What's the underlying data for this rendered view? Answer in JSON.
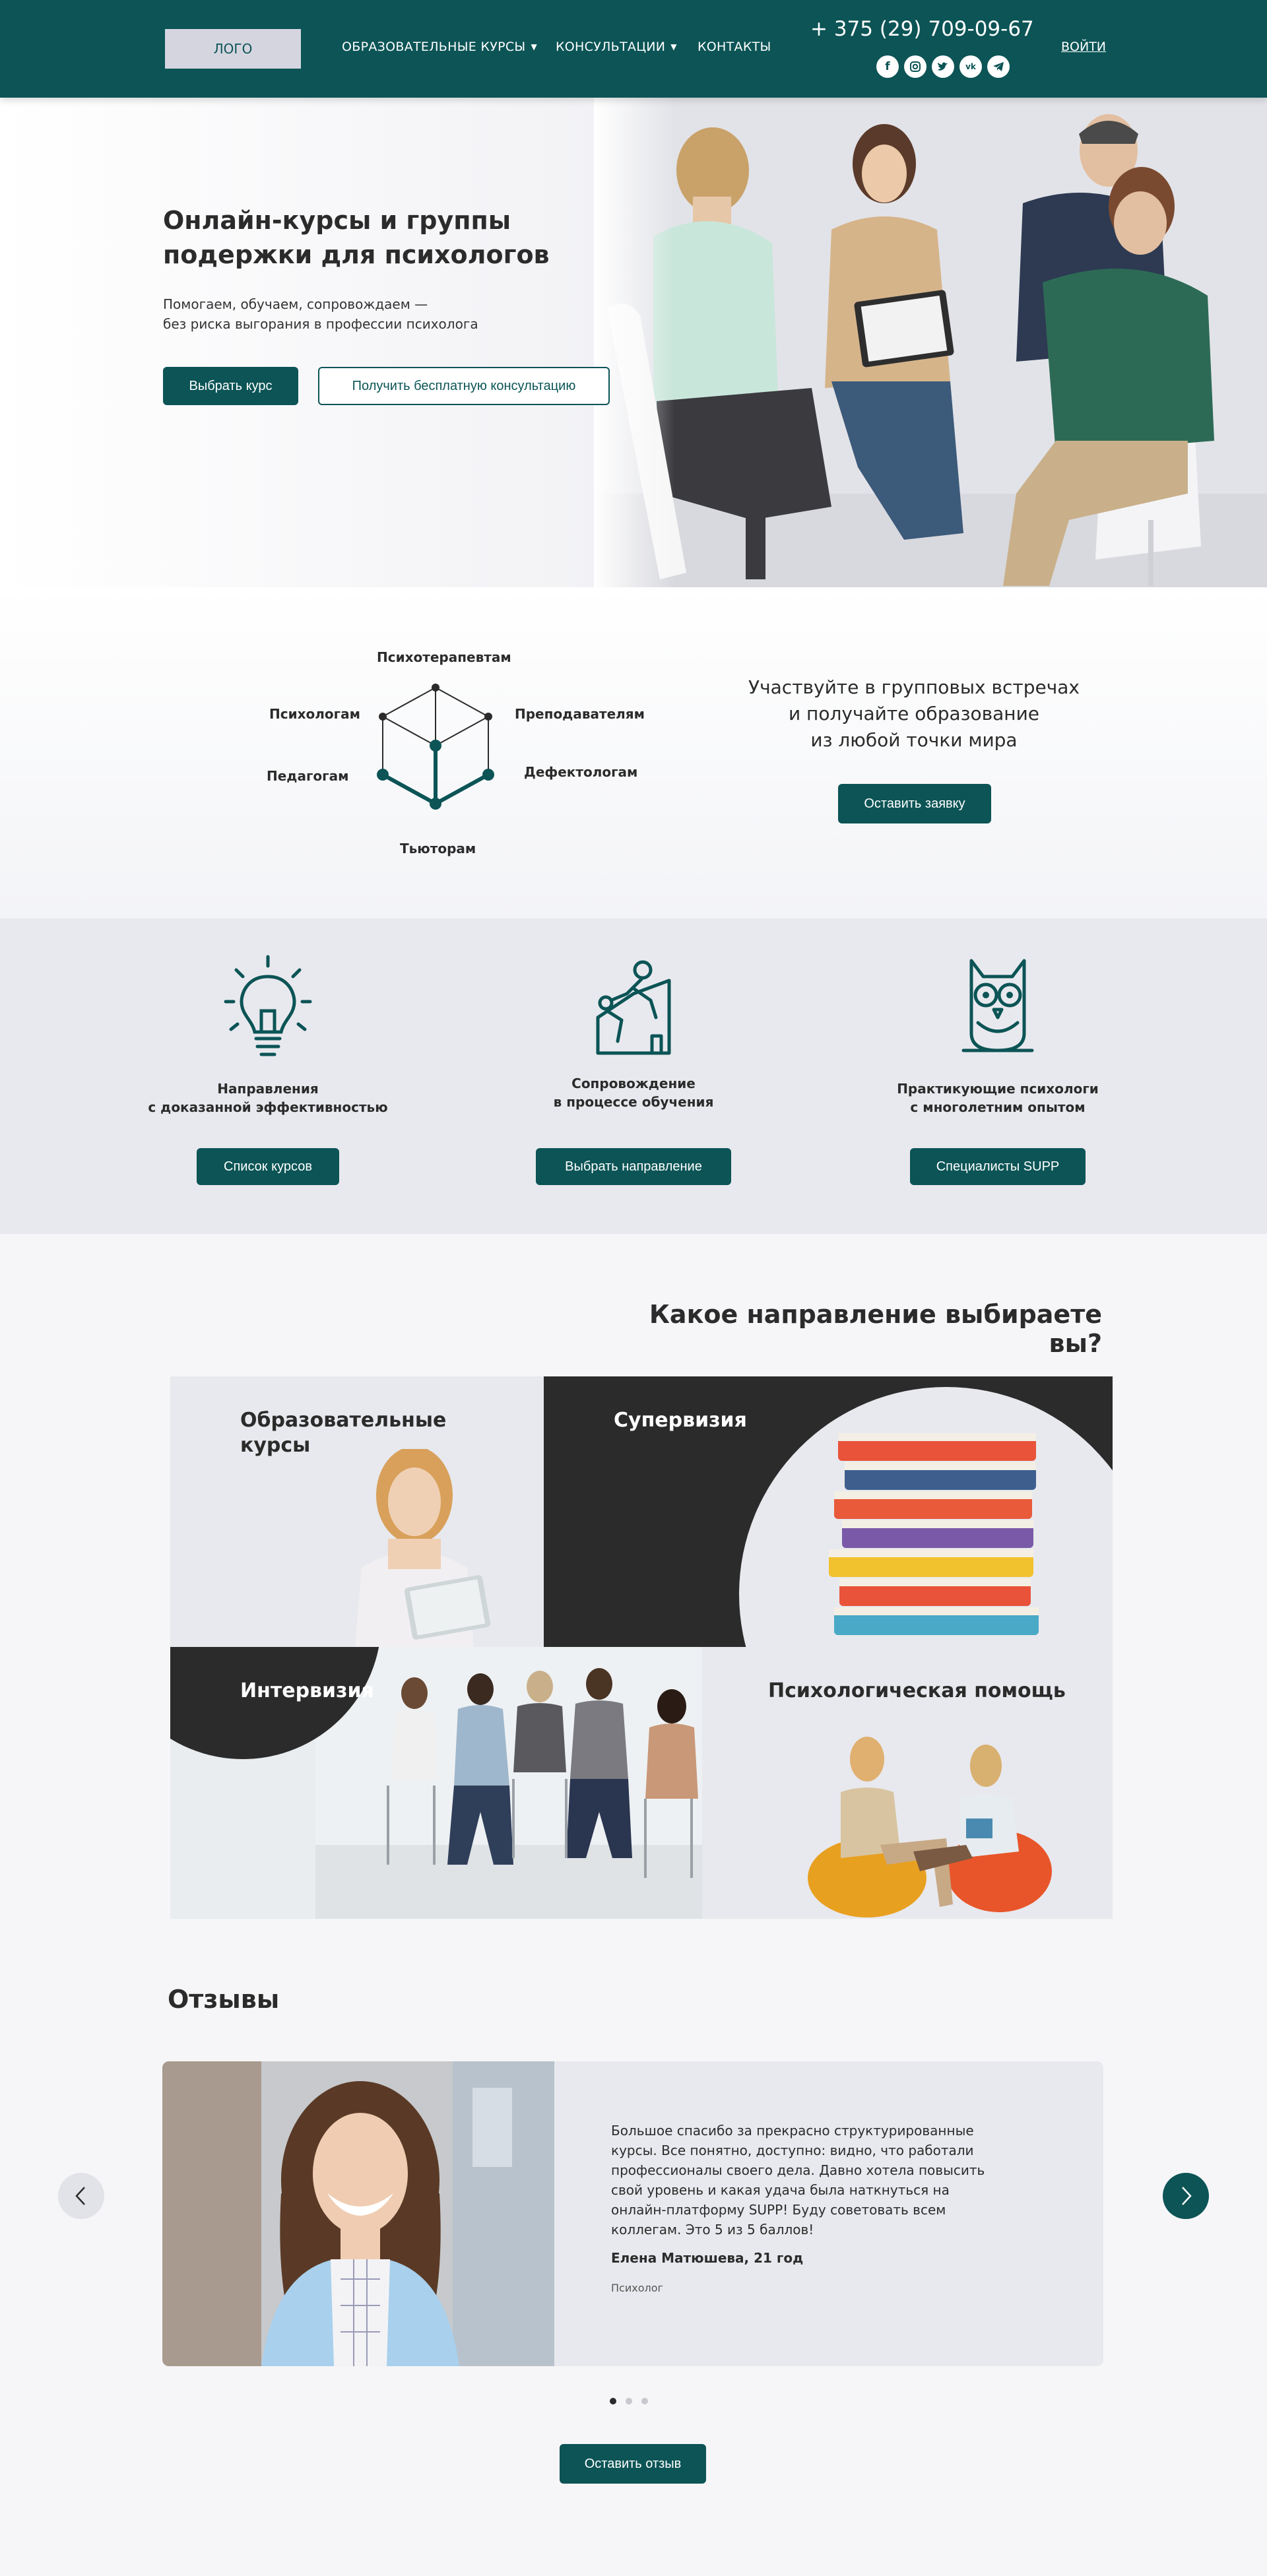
{
  "header": {
    "logo": "ЛОГО",
    "nav": [
      {
        "label": "ОБРАЗОВАТЕЛЬНЫЕ КУРСЫ",
        "has_dropdown": true
      },
      {
        "label": "КОНСУЛЬТАЦИИ",
        "has_dropdown": true
      },
      {
        "label": "КОНТАКТЫ",
        "has_dropdown": false
      }
    ],
    "phone": "+ 375 (29) 709-09-67",
    "socials": [
      "facebook-icon",
      "instagram-icon",
      "twitter-icon",
      "vk-icon",
      "telegram-icon"
    ],
    "login": "ВОЙТИ"
  },
  "hero": {
    "title": "Онлайн-курсы и группы подержки для психологов",
    "subtitle_line1": "Помогаем, обучаем, сопровождаем —",
    "subtitle_line2": "без риска выгорания в профессии психолога",
    "primary_button": "Выбрать курс",
    "secondary_button": "Получить бесплатную консультацию"
  },
  "audience": {
    "labels": {
      "top": "Психотерапевтам",
      "left_top": "Психологам",
      "right_top": "Преподавателям",
      "left_bottom": "Педагогам",
      "right_bottom": "Дефектологам",
      "bottom": "Тьюторам"
    },
    "text_line1": "Участвуйте в групповых встречах",
    "text_line2": "и получайте образование",
    "text_line3": "из любой точки мира",
    "button": "Оставить заявку"
  },
  "features": [
    {
      "icon": "lightbulb-icon",
      "title_line1": "Направления",
      "title_line2": "с доказанной эффективностью",
      "button": "Список курсов"
    },
    {
      "icon": "climbing-support-icon",
      "title_line1": "Сопровождение",
      "title_line2": "в процессе обучения",
      "button": "Выбрать направление"
    },
    {
      "icon": "owl-icon",
      "title_line1": "Практикующие психологи",
      "title_line2": "с многолетним опытом",
      "button": "Специалисты SUPP"
    }
  ],
  "directions": {
    "title": "Какое направление выбираете вы?",
    "tiles": [
      {
        "label_line1": "Образовательные",
        "label_line2": "курсы"
      },
      {
        "label_line1": "Супервизия",
        "label_line2": ""
      },
      {
        "label_line1": "Интервизия",
        "label_line2": ""
      },
      {
        "label_line1": "Психологическая помощь",
        "label_line2": ""
      }
    ]
  },
  "reviews": {
    "title": "Отзывы",
    "text": "Большое спасибо за прекрасно структурированные курсы. Все понятно, доступно: видно, что работали профессионалы своего дела. Давно хотела повысить свой  уровень и какая удача была наткнуться на онлайн-платформу SUPP! Буду советовать всем коллегам. Это 5 из 5 баллов!",
    "author": "Елена Матюшева, 21 год",
    "role": "Психолог",
    "slide_count": 3,
    "active_slide": 1,
    "button": "Оставить отзыв"
  },
  "colors": {
    "brand": "#0c5456",
    "dark": "#2b2b2b",
    "light_bg": "#e8e9ee"
  }
}
